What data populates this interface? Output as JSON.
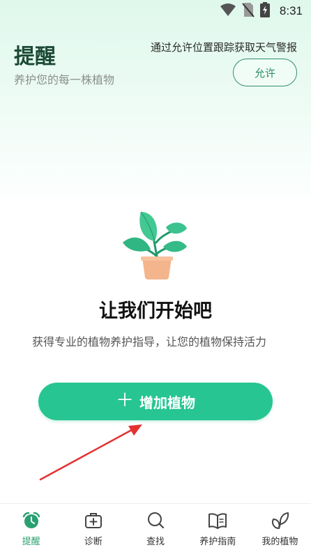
{
  "status_bar": {
    "time": "8:31",
    "icons": [
      "wifi-icon",
      "no-sim-icon",
      "battery-charging-icon"
    ]
  },
  "header": {
    "title": "提醒",
    "subtitle": "养护您的每一株植物",
    "location_prompt": "通过允许位置跟踪获取天气警报",
    "allow_label": "允许"
  },
  "empty_state": {
    "icon": "potted-plant-icon",
    "title": "让我们开始吧",
    "description": "获得专业的植物养护指导，让您的植物保持活力",
    "add_button_icon": "plus-icon",
    "add_button_label": "增加植物"
  },
  "bottom_nav": {
    "active": "提醒",
    "items": [
      {
        "label": "提醒",
        "icon": "alarm-clock-icon"
      },
      {
        "label": "诊断",
        "icon": "medical-kit-icon"
      },
      {
        "label": "查找",
        "icon": "search-icon"
      },
      {
        "label": "养护指南",
        "icon": "open-book-icon"
      },
      {
        "label": "我的植物",
        "icon": "leaves-icon"
      }
    ]
  },
  "colors": {
    "accent": "#27c591",
    "title_dark_green": "#1c4a37",
    "nav_active": "#2aa070",
    "annotation_arrow": "#e53030"
  }
}
